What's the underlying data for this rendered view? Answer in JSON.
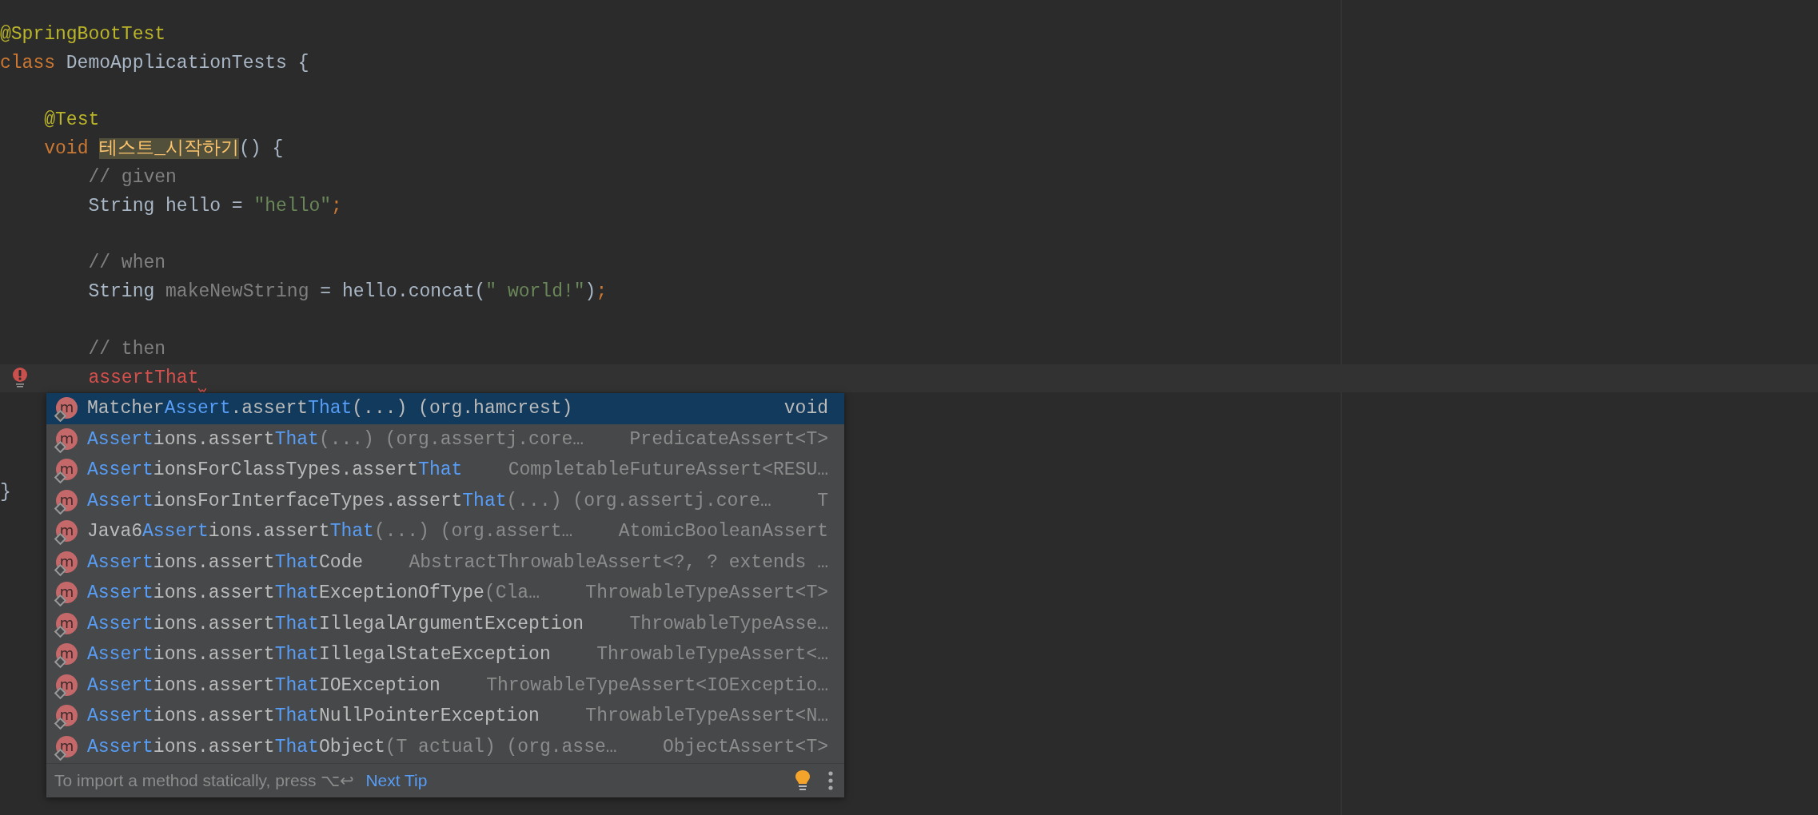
{
  "editor": {
    "blocks": [
      {
        "lines": [
          {
            "tokens": [
              {
                "text": "@SpringBootTest",
                "kind": "annotation"
              }
            ]
          },
          {
            "tokens": [
              {
                "text": "class",
                "kind": "keyword"
              },
              {
                "text": " DemoApplicationTests {",
                "kind": "text"
              }
            ]
          }
        ]
      },
      {
        "lines": [
          {
            "tokens": [
              {
                "text": "    @Test",
                "kind": "annotation"
              }
            ]
          },
          {
            "tokens": [
              {
                "text": "    void ",
                "kind": "keyword"
              },
              {
                "text": "테스트_시작하기",
                "kind": "usage-highlight"
              },
              {
                "text": "() {",
                "kind": "text"
              }
            ]
          },
          {
            "tokens": [
              {
                "text": "        // given",
                "kind": "comment"
              }
            ]
          },
          {
            "tokens": [
              {
                "text": "        String hello = ",
                "kind": "text"
              },
              {
                "text": "\"hello\"",
                "kind": "string"
              },
              {
                "text": ";",
                "kind": "keyword"
              }
            ]
          }
        ]
      },
      {
        "lines": [
          {
            "tokens": [
              {
                "text": "        // when",
                "kind": "comment"
              }
            ]
          },
          {
            "tokens": [
              {
                "text": "        String ",
                "kind": "text"
              },
              {
                "text": "makeNewString",
                "kind": "unused"
              },
              {
                "text": " = hello.concat(",
                "kind": "text"
              },
              {
                "text": "\" world!\"",
                "kind": "string"
              },
              {
                "text": ")",
                "kind": "text"
              },
              {
                "text": ";",
                "kind": "keyword"
              }
            ]
          }
        ]
      },
      {
        "lines": [
          {
            "tokens": [
              {
                "text": "        // then",
                "kind": "comment"
              }
            ]
          },
          {
            "tokens": [
              {
                "text": "        assertThat",
                "kind": "error"
              }
            ],
            "current": true,
            "error_marker": true
          }
        ]
      },
      {
        "lines": [
          {
            "tokens": [
              {
                "text": "}",
                "kind": "text"
              }
            ]
          }
        ]
      }
    ]
  },
  "completion": {
    "items": [
      {
        "selected": true,
        "badge": "m",
        "segments": [
          {
            "text": "Matcher",
            "kind": "name"
          },
          {
            "text": "Assert",
            "kind": "match"
          },
          {
            "text": ".assert",
            "kind": "name"
          },
          {
            "text": "That",
            "kind": "match"
          },
          {
            "text": "(...) (org.hamcrest)",
            "kind": "name"
          }
        ],
        "type": "void"
      },
      {
        "selected": false,
        "badge": "m",
        "segments": [
          {
            "text": "Assert",
            "kind": "match"
          },
          {
            "text": "ions.assert",
            "kind": "name"
          },
          {
            "text": "That",
            "kind": "match"
          },
          {
            "text": "(...) (org.assertj.core…",
            "kind": "dim"
          }
        ],
        "type": "PredicateAssert<T>"
      },
      {
        "selected": false,
        "badge": "m",
        "segments": [
          {
            "text": "Assert",
            "kind": "match"
          },
          {
            "text": "ionsForClassTypes.assert",
            "kind": "name"
          },
          {
            "text": "That",
            "kind": "match"
          }
        ],
        "type": "CompletableFutureAssert<RESU…"
      },
      {
        "selected": false,
        "badge": "m",
        "segments": [
          {
            "text": "Assert",
            "kind": "match"
          },
          {
            "text": "ionsForInterfaceTypes.assert",
            "kind": "name"
          },
          {
            "text": "That",
            "kind": "match"
          },
          {
            "text": "(...) (org.assertj.core…",
            "kind": "dim"
          }
        ],
        "type": "T"
      },
      {
        "selected": false,
        "badge": "m",
        "segments": [
          {
            "text": "Java6",
            "kind": "name"
          },
          {
            "text": "Assert",
            "kind": "match"
          },
          {
            "text": "ions.assert",
            "kind": "name"
          },
          {
            "text": "That",
            "kind": "match"
          },
          {
            "text": "(...) (org.assert…",
            "kind": "dim"
          }
        ],
        "type": "AtomicBooleanAssert"
      },
      {
        "selected": false,
        "badge": "m",
        "segments": [
          {
            "text": "Assert",
            "kind": "match"
          },
          {
            "text": "ions.assert",
            "kind": "name"
          },
          {
            "text": "That",
            "kind": "match"
          },
          {
            "text": "Code",
            "kind": "name"
          }
        ],
        "type": "AbstractThrowableAssert<?, ? extends …"
      },
      {
        "selected": false,
        "badge": "m",
        "segments": [
          {
            "text": "Assert",
            "kind": "match"
          },
          {
            "text": "ions.assert",
            "kind": "name"
          },
          {
            "text": "That",
            "kind": "match"
          },
          {
            "text": "ExceptionOfType",
            "kind": "name"
          },
          {
            "text": "(Cla…",
            "kind": "dim"
          }
        ],
        "type": "ThrowableTypeAssert<T>"
      },
      {
        "selected": false,
        "badge": "m",
        "segments": [
          {
            "text": "Assert",
            "kind": "match"
          },
          {
            "text": "ions.assert",
            "kind": "name"
          },
          {
            "text": "That",
            "kind": "match"
          },
          {
            "text": "IllegalArgumentException",
            "kind": "name"
          }
        ],
        "type": "ThrowableTypeAsse…"
      },
      {
        "selected": false,
        "badge": "m",
        "segments": [
          {
            "text": "Assert",
            "kind": "match"
          },
          {
            "text": "ions.assert",
            "kind": "name"
          },
          {
            "text": "That",
            "kind": "match"
          },
          {
            "text": "IllegalStateException",
            "kind": "name"
          }
        ],
        "type": "ThrowableTypeAssert<…"
      },
      {
        "selected": false,
        "badge": "m",
        "segments": [
          {
            "text": "Assert",
            "kind": "match"
          },
          {
            "text": "ions.assert",
            "kind": "name"
          },
          {
            "text": "That",
            "kind": "match"
          },
          {
            "text": "IOException",
            "kind": "name"
          }
        ],
        "type": "ThrowableTypeAssert<IOExceptio…"
      },
      {
        "selected": false,
        "badge": "m",
        "segments": [
          {
            "text": "Assert",
            "kind": "match"
          },
          {
            "text": "ions.assert",
            "kind": "name"
          },
          {
            "text": "That",
            "kind": "match"
          },
          {
            "text": "NullPointerException",
            "kind": "name"
          }
        ],
        "type": "ThrowableTypeAssert<N…"
      },
      {
        "selected": false,
        "badge": "m",
        "segments": [
          {
            "text": "Assert",
            "kind": "match"
          },
          {
            "text": "ions.assert",
            "kind": "name"
          },
          {
            "text": "That",
            "kind": "match"
          },
          {
            "text": "Object",
            "kind": "name"
          },
          {
            "text": "(T actual) (org.asse…",
            "kind": "dim"
          }
        ],
        "type": "ObjectAssert<T>"
      }
    ],
    "footer": {
      "hint": "To import a method statically, press ⌥↩",
      "link": "Next Tip"
    }
  }
}
